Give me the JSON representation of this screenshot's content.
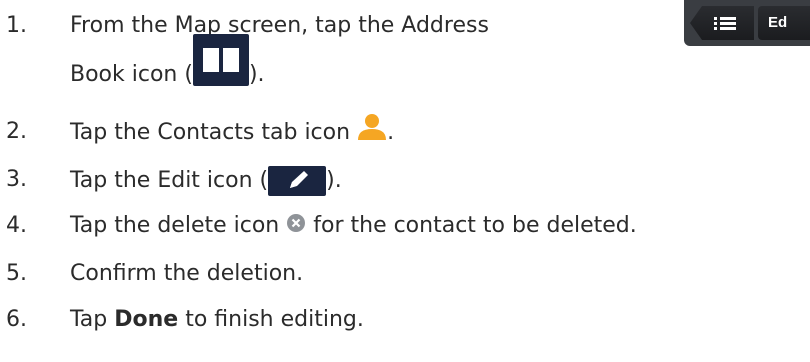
{
  "steps": [
    {
      "number": "1.",
      "line1": "From the Map screen, tap the Address",
      "line2_prefix": "Book icon (",
      "line2_suffix": ")."
    },
    {
      "number": "2.",
      "text": "Tap the Contacts tab icon",
      "suffix": "."
    },
    {
      "number": "3.",
      "text": "Tap the Edit icon (",
      "suffix": ")."
    },
    {
      "number": "4.",
      "text": "Tap the delete icon",
      "suffix": "for the contact to be deleted."
    },
    {
      "number": "5.",
      "text": "Confirm the deletion."
    },
    {
      "number": "6.",
      "prefix": "Tap",
      "bold": "Done",
      "suffix": "to finish editing."
    }
  ],
  "toolbar": {
    "edit_label": "Ed"
  },
  "colors": {
    "icon_bg": "#1a2540",
    "contact_icon": "#f5a623",
    "toolbar_bg": "#3a3d42"
  },
  "icons": [
    "book-icon",
    "contact-icon",
    "pencil-icon",
    "delete-icon",
    "list-icon"
  ]
}
